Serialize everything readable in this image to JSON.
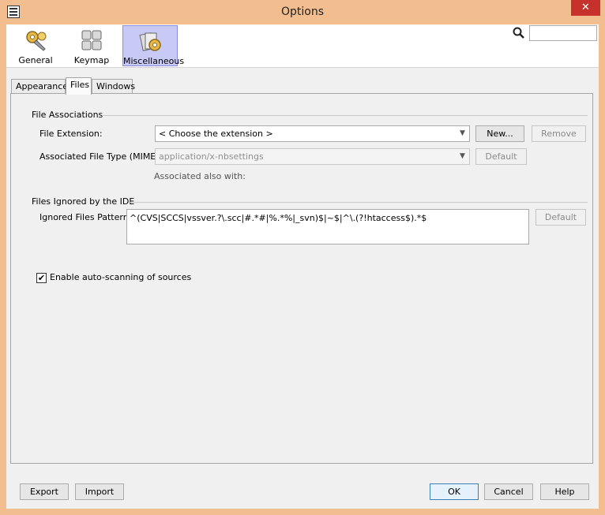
{
  "window": {
    "title": "Options",
    "close_glyph": "✕"
  },
  "categories": [
    {
      "label": "General",
      "icon": "gears-icon",
      "selected": false
    },
    {
      "label": "Keymap",
      "icon": "keyboard-icon",
      "selected": false
    },
    {
      "label": "Miscellaneous",
      "icon": "misc-icon",
      "selected": true
    }
  ],
  "search": {
    "value": ""
  },
  "tabs": [
    {
      "label": "Appearance"
    },
    {
      "label": "Files",
      "active": true
    },
    {
      "label": "Windows"
    }
  ],
  "file_associations": {
    "title": "File Associations",
    "ext_label": "File Extension:",
    "ext_value": "< Choose the extension >",
    "new_button": "New...",
    "remove_button": "Remove",
    "mime_label": "Associated File Type (MIME):",
    "mime_value": "application/x-nbsettings",
    "default_button": "Default",
    "also_with": "Associated also with:"
  },
  "files_ignored": {
    "title": "Files Ignored by the IDE",
    "pattern_label": "Ignored Files Pattern:",
    "pattern_value": "^(CVS|SCCS|vssver.?\\.scc|#.*#|%.*%|_svn)$|~$|^\\.(?!htaccess$).*$",
    "default_button": "Default"
  },
  "auto_scan": {
    "label": "Enable auto-scanning of sources",
    "checked": true,
    "check_glyph": "✔"
  },
  "footer": {
    "export": "Export",
    "import": "Import",
    "ok": "OK",
    "cancel": "Cancel",
    "help": "Help"
  }
}
